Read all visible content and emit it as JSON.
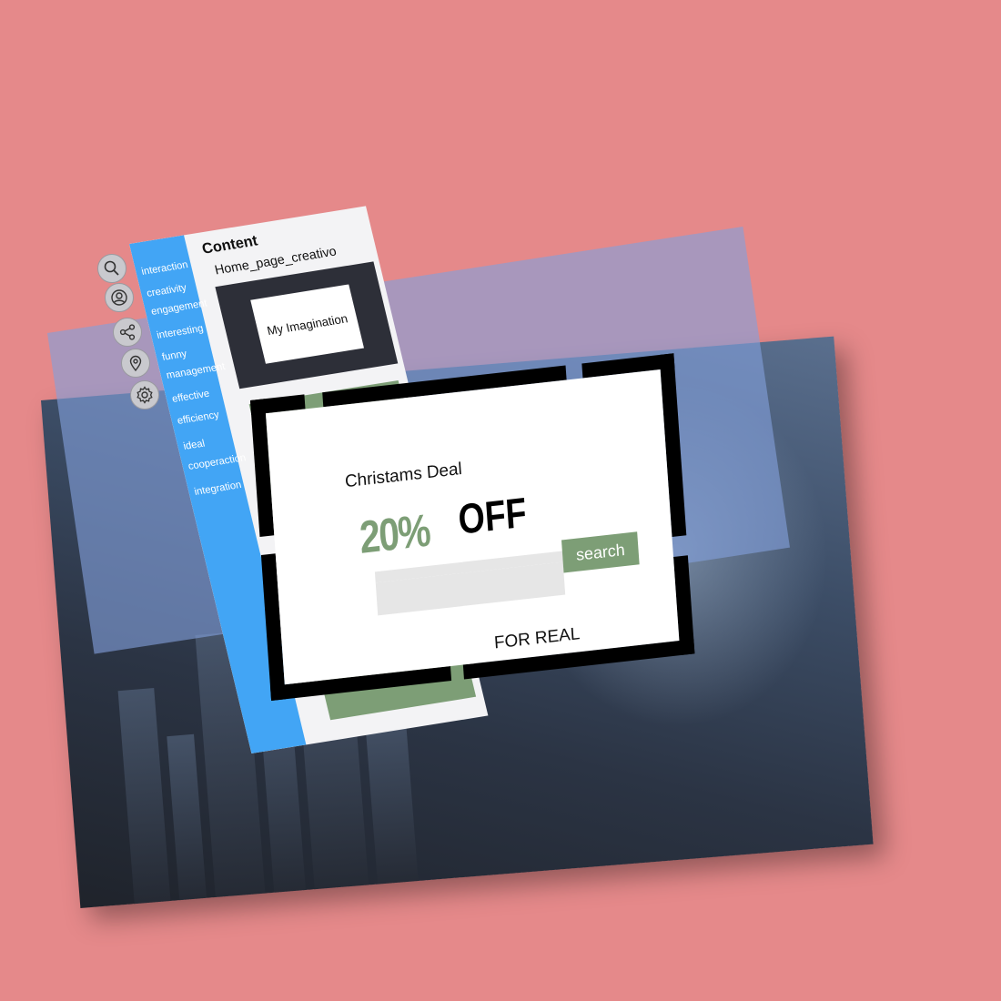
{
  "sidebar": {
    "items": [
      {
        "label": "interaction"
      },
      {
        "label": "creativity"
      },
      {
        "label": "engagement"
      },
      {
        "label": "interesting"
      },
      {
        "label": "funny"
      },
      {
        "label": "management"
      },
      {
        "label": "effective"
      },
      {
        "label": "efficiency"
      },
      {
        "label": "ideal"
      },
      {
        "label": "cooperaction"
      },
      {
        "label": "integration"
      }
    ]
  },
  "content": {
    "title": "Content",
    "subtitle": "Home_page_creativo",
    "card_label": "My Imagination"
  },
  "toolbar_icons": [
    "search-icon",
    "user-icon",
    "share-icon",
    "location-icon",
    "gear-icon"
  ],
  "deal": {
    "heading": "Christams Deal",
    "percent": "20%",
    "off": "OFF",
    "search_label": "search",
    "footer": "FOR REAL"
  },
  "colors": {
    "background": "#e5898a",
    "sidebar": "#42a5f5",
    "accent_green": "#7d9e76",
    "overlay_blue": "#82a0dc"
  }
}
